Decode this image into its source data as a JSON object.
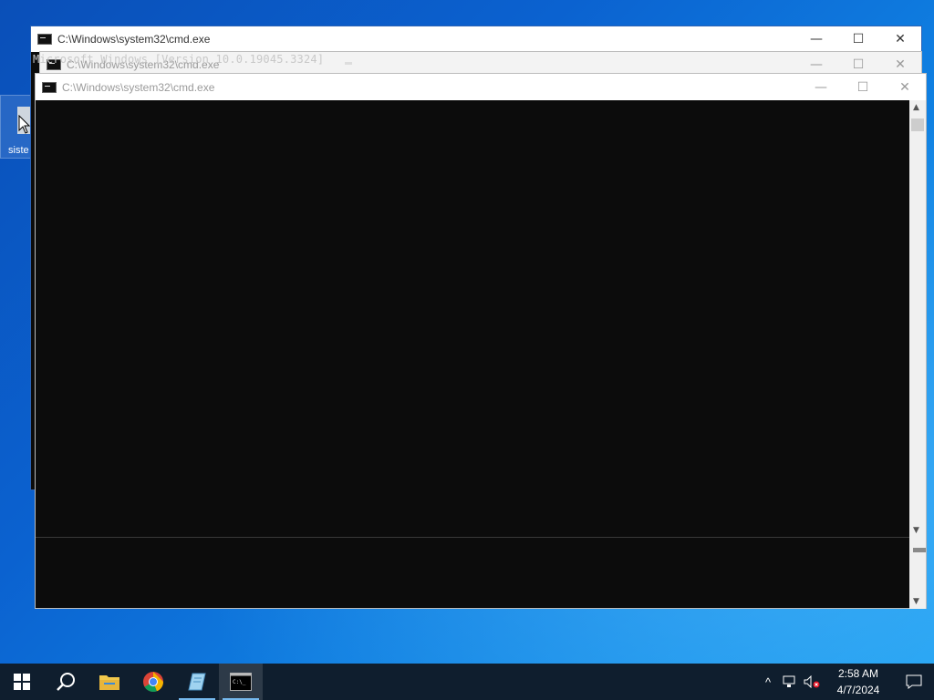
{
  "desktop": {
    "icon_label": "siste"
  },
  "windows": [
    {
      "title": "C:\\Windows\\system32\\cmd.exe",
      "minimize": "—",
      "maximize": "☐",
      "close": "✕"
    },
    {
      "title": "C:\\Windows\\system32\\cmd.exe",
      "minimize": "—",
      "maximize": "☐",
      "close": "✕",
      "console_text": "Microsoft Windows [Version 10.0.19045.3324]"
    },
    {
      "title": "C:\\Windows\\system32\\cmd.exe",
      "minimize": "—",
      "maximize": "☐",
      "close": "✕"
    }
  ],
  "scrollbar": {
    "up": "▲",
    "down": "▼"
  },
  "taskbar": {
    "items": [
      "start-icon",
      "search-icon",
      "file-explorer-icon",
      "chrome-icon",
      "notepad-icon",
      "cmd-icon"
    ],
    "tray": {
      "chevron": "^",
      "time": "2:58 AM",
      "date": "4/7/2024"
    }
  },
  "colors": {
    "console_bg": "#0c0c0c",
    "taskbar_bg": "#0f1e2e",
    "accent": "#76b9ed"
  }
}
